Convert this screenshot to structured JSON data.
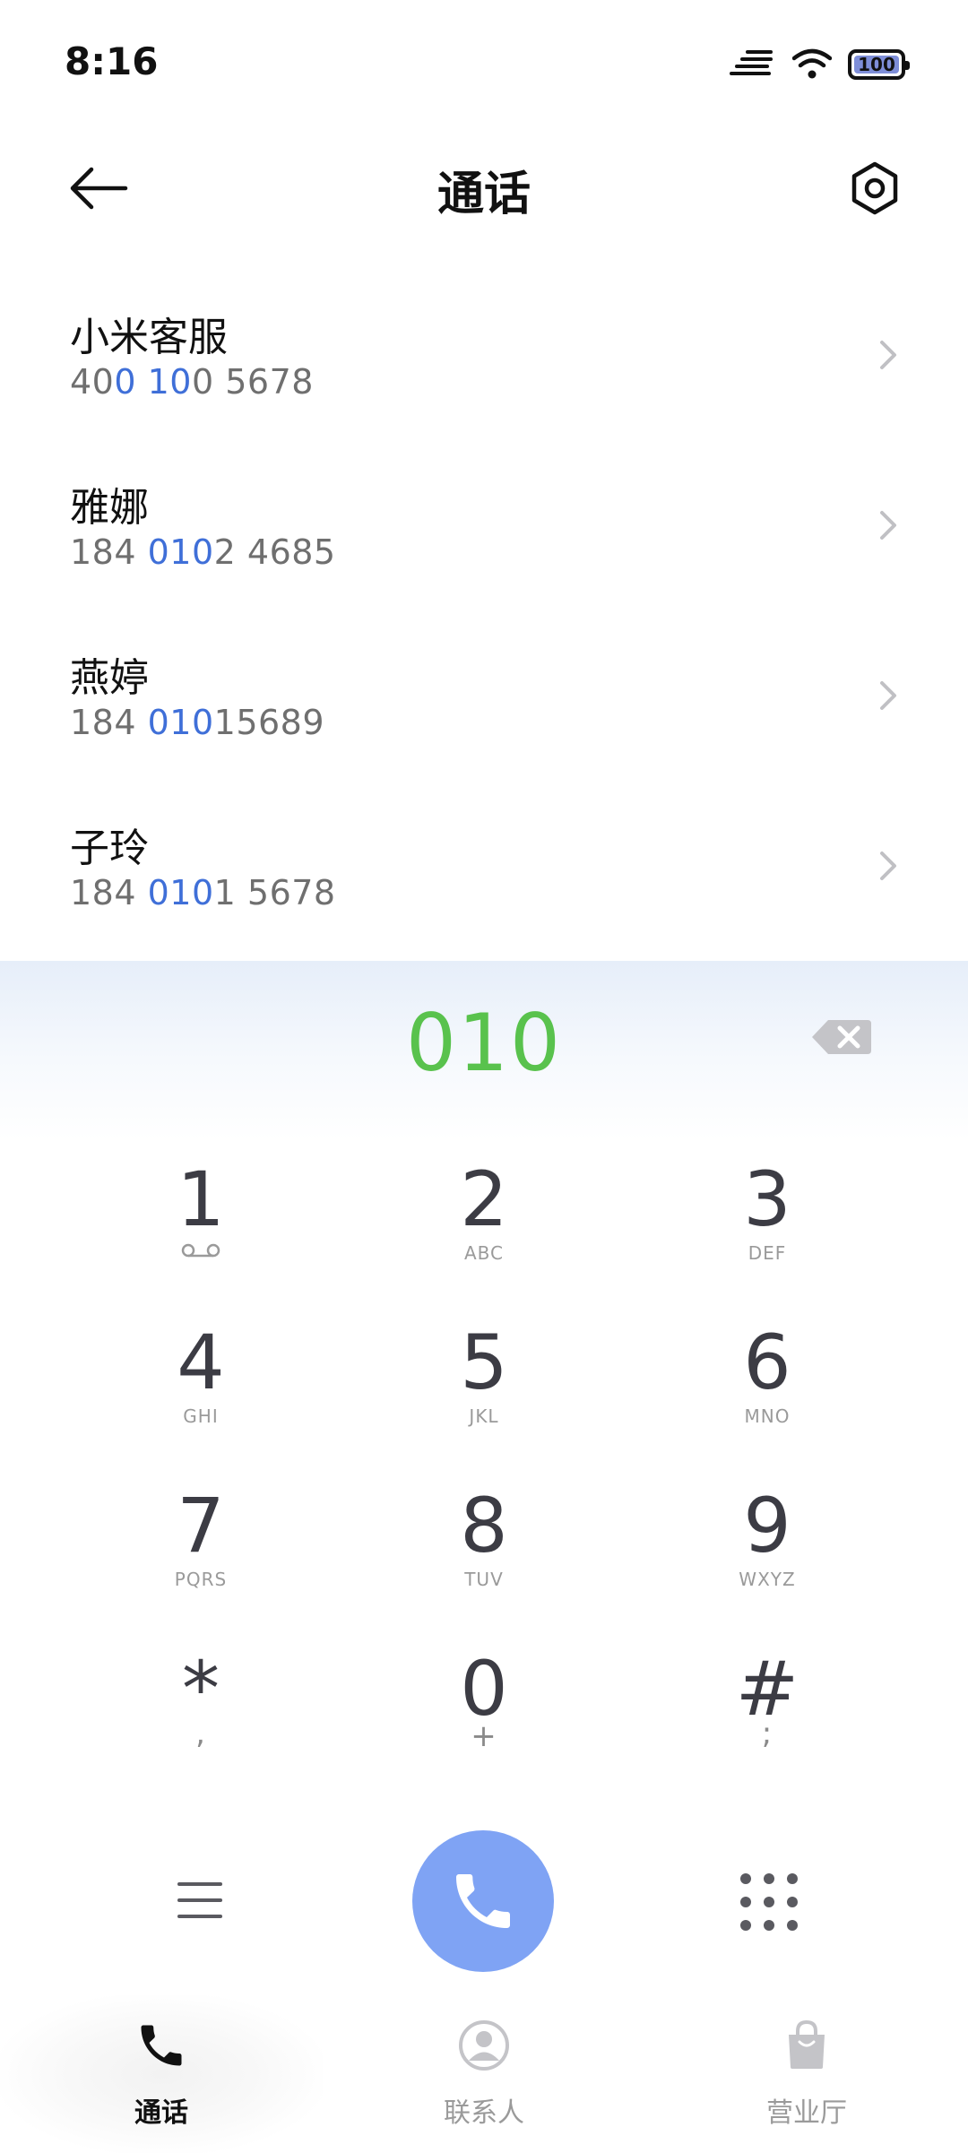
{
  "status_bar": {
    "time": "8:16",
    "battery": "100",
    "icons": [
      "data-speed-icon",
      "wifi-icon",
      "battery-icon"
    ]
  },
  "header": {
    "title": "通话",
    "back_icon": "back-arrow-icon",
    "settings_icon": "settings-icon"
  },
  "results": [
    {
      "name": "小米客服",
      "number_parts": [
        "40",
        "0 10",
        "0 5678"
      ]
    },
    {
      "name": "雅娜",
      "number_parts": [
        "184 ",
        "010",
        "2 4685"
      ]
    },
    {
      "name": "燕婷",
      "number_parts": [
        "184 ",
        "010",
        "15689"
      ]
    },
    {
      "name": "子玲",
      "number_parts": [
        "184 ",
        "010",
        "1 5678"
      ]
    }
  ],
  "dialer": {
    "input": "010",
    "keys": [
      {
        "digit": "1",
        "sub": ""
      },
      {
        "digit": "2",
        "sub": "ABC"
      },
      {
        "digit": "3",
        "sub": "DEF"
      },
      {
        "digit": "4",
        "sub": "GHI"
      },
      {
        "digit": "5",
        "sub": "JKL"
      },
      {
        "digit": "6",
        "sub": "MNO"
      },
      {
        "digit": "7",
        "sub": "PQRS"
      },
      {
        "digit": "8",
        "sub": "TUV"
      },
      {
        "digit": "9",
        "sub": "WXYZ"
      },
      {
        "digit": "*",
        "sub": ","
      },
      {
        "digit": "0",
        "sub": "+"
      },
      {
        "digit": "#",
        "sub": ";"
      }
    ]
  },
  "bottom_nav": [
    {
      "label": "通话",
      "icon": "phone-icon",
      "active": true
    },
    {
      "label": "联系人",
      "icon": "contact-icon",
      "active": false
    },
    {
      "label": "营业厅",
      "icon": "shopping-bag-icon",
      "active": false
    }
  ],
  "colors": {
    "accent_blue": "#3f6fd8",
    "dial_green": "#59c24d",
    "call_button": "#7fa3f4"
  }
}
